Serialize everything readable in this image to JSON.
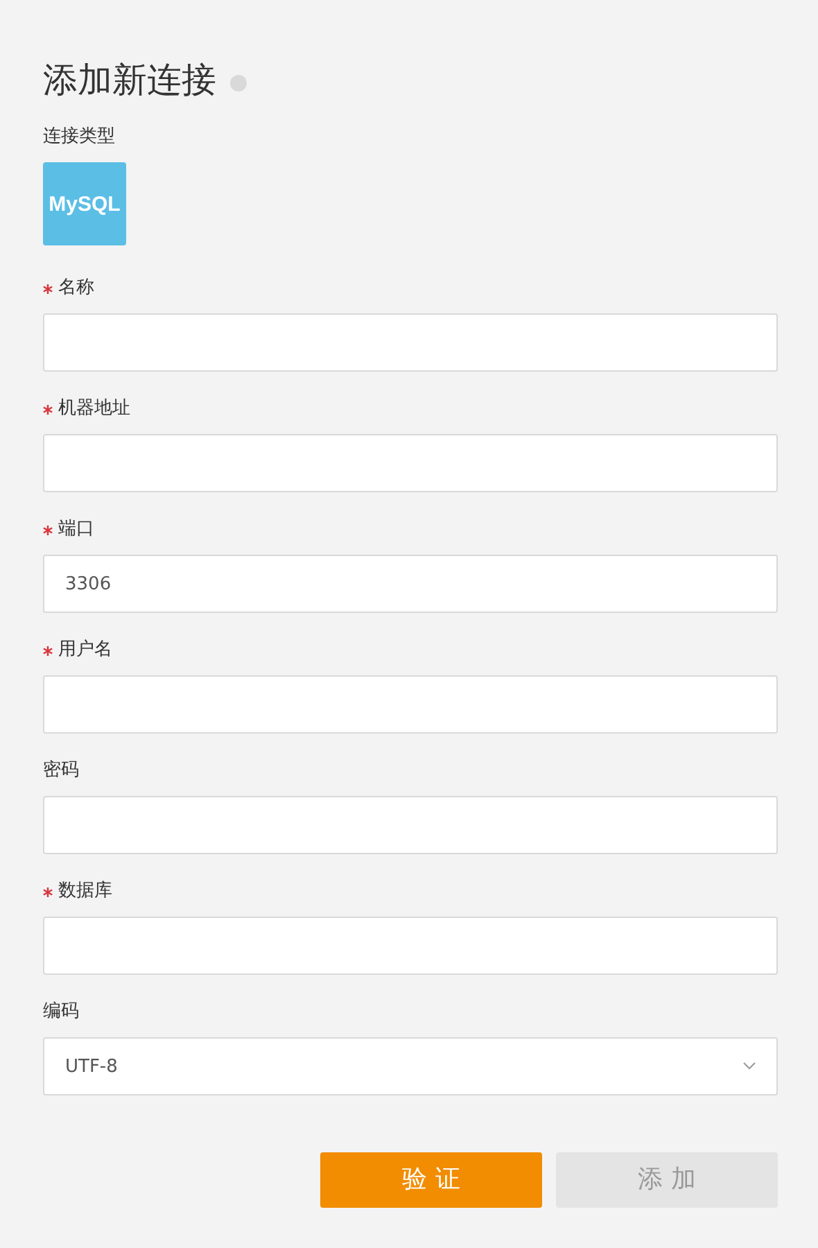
{
  "title": "添加新连接",
  "connection_type": {
    "label": "连接类型",
    "logo": "MySQL"
  },
  "fields": [
    {
      "kind": "input",
      "label": "名称",
      "required": true
    },
    {
      "kind": "input",
      "label": "机器地址",
      "required": true
    },
    {
      "kind": "input",
      "label": "端口",
      "required": true,
      "value": "3306"
    },
    {
      "kind": "input",
      "label": "用户名",
      "required": true
    },
    {
      "kind": "input",
      "label": "密码",
      "required": false
    },
    {
      "kind": "input",
      "label": "数据库",
      "required": true
    },
    {
      "kind": "select",
      "label": "编码",
      "required": false,
      "value": "UTF-8"
    }
  ],
  "buttons": [
    {
      "label": "验证",
      "disabled": false
    },
    {
      "label": "添加",
      "disabled": true
    }
  ]
}
